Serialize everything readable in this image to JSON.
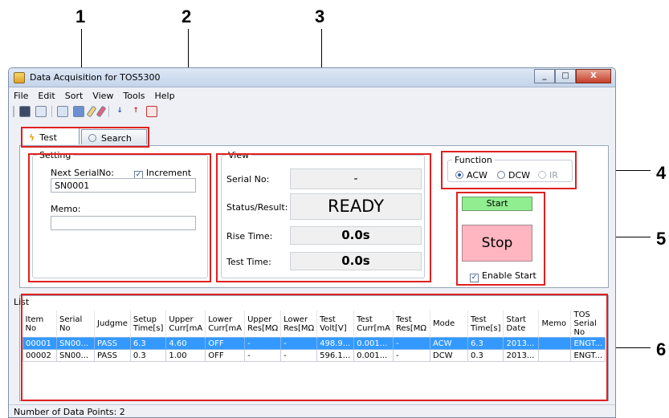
{
  "callouts": [
    "1",
    "2",
    "3",
    "4",
    "5",
    "6"
  ],
  "window": {
    "title": "Data Acquisition for TOS5300",
    "buttons": {
      "minimize": "_",
      "maximize": "□",
      "close": "X"
    }
  },
  "menu": [
    "File",
    "Edit",
    "Sort",
    "View",
    "Tools",
    "Help"
  ],
  "toolbar_icons": [
    "save-icon",
    "save-as-icon",
    "copy-icon",
    "paste-icon",
    "edit-pencil-icon",
    "eraser-icon",
    "sort-ascending-icon",
    "sort-descending-icon",
    "filter-icon"
  ],
  "tabs": [
    {
      "label": "Test",
      "icon": "lightning-icon",
      "active": true
    },
    {
      "label": "Search",
      "icon": "magnifier-icon",
      "active": false
    }
  ],
  "setting": {
    "legend": "Setting",
    "next_serial_label": "Next SerialNo:",
    "increment_label": "Increment",
    "increment_checked": true,
    "serial_value": "SN0001",
    "memo_label": "Memo:",
    "memo_value": ""
  },
  "view": {
    "legend": "View",
    "serial_label": "Serial No:",
    "serial_value": "-",
    "status_label": "Status/Result:",
    "status_value": "READY",
    "rise_label": "Rise Time:",
    "rise_value": "0.0s",
    "test_label": "Test Time:",
    "test_value": "0.0s"
  },
  "function": {
    "legend": "Function",
    "options": [
      {
        "label": "ACW",
        "selected": true,
        "enabled": true
      },
      {
        "label": "DCW",
        "selected": false,
        "enabled": true
      },
      {
        "label": "IR",
        "selected": false,
        "enabled": false
      }
    ]
  },
  "control": {
    "start_label": "Start",
    "stop_label": "Stop",
    "enable_start_label": "Enable Start",
    "enable_start_checked": true
  },
  "list": {
    "title": "List",
    "columns": [
      "Item No",
      "Serial No",
      "Judgme",
      "Setup Time[s]",
      "Upper Curr[mA",
      "Lower Curr[mA",
      "Upper Res[MΩ",
      "Lower Res[MΩ",
      "Test Volt[V]",
      "Test Curr[mA",
      "Test Res[MΩ",
      "Mode",
      "Test Time[s]",
      "Start Date",
      "Memo",
      "TOS Serial No"
    ],
    "rows": [
      [
        "00001",
        "SN00...",
        "PASS",
        "6.3",
        "4.60",
        "OFF",
        "-",
        "-",
        "498.9...",
        "0.001...",
        "-",
        "ACW",
        "6.3",
        "2013...",
        "",
        "ENGT..."
      ],
      [
        "00002",
        "SN00...",
        "PASS",
        "0.3",
        "1.00",
        "OFF",
        "-",
        "-",
        "596.1...",
        "0.001...",
        "-",
        "DCW",
        "0.3",
        "2013...",
        "",
        "ENGT..."
      ]
    ],
    "selected_row": 0
  },
  "status_bar": "Number of Data Points:  2",
  "colors": {
    "highlight": "#e02020",
    "start": "#90ee90",
    "stop": "#ffb6c1",
    "selection": "#3399ff"
  }
}
